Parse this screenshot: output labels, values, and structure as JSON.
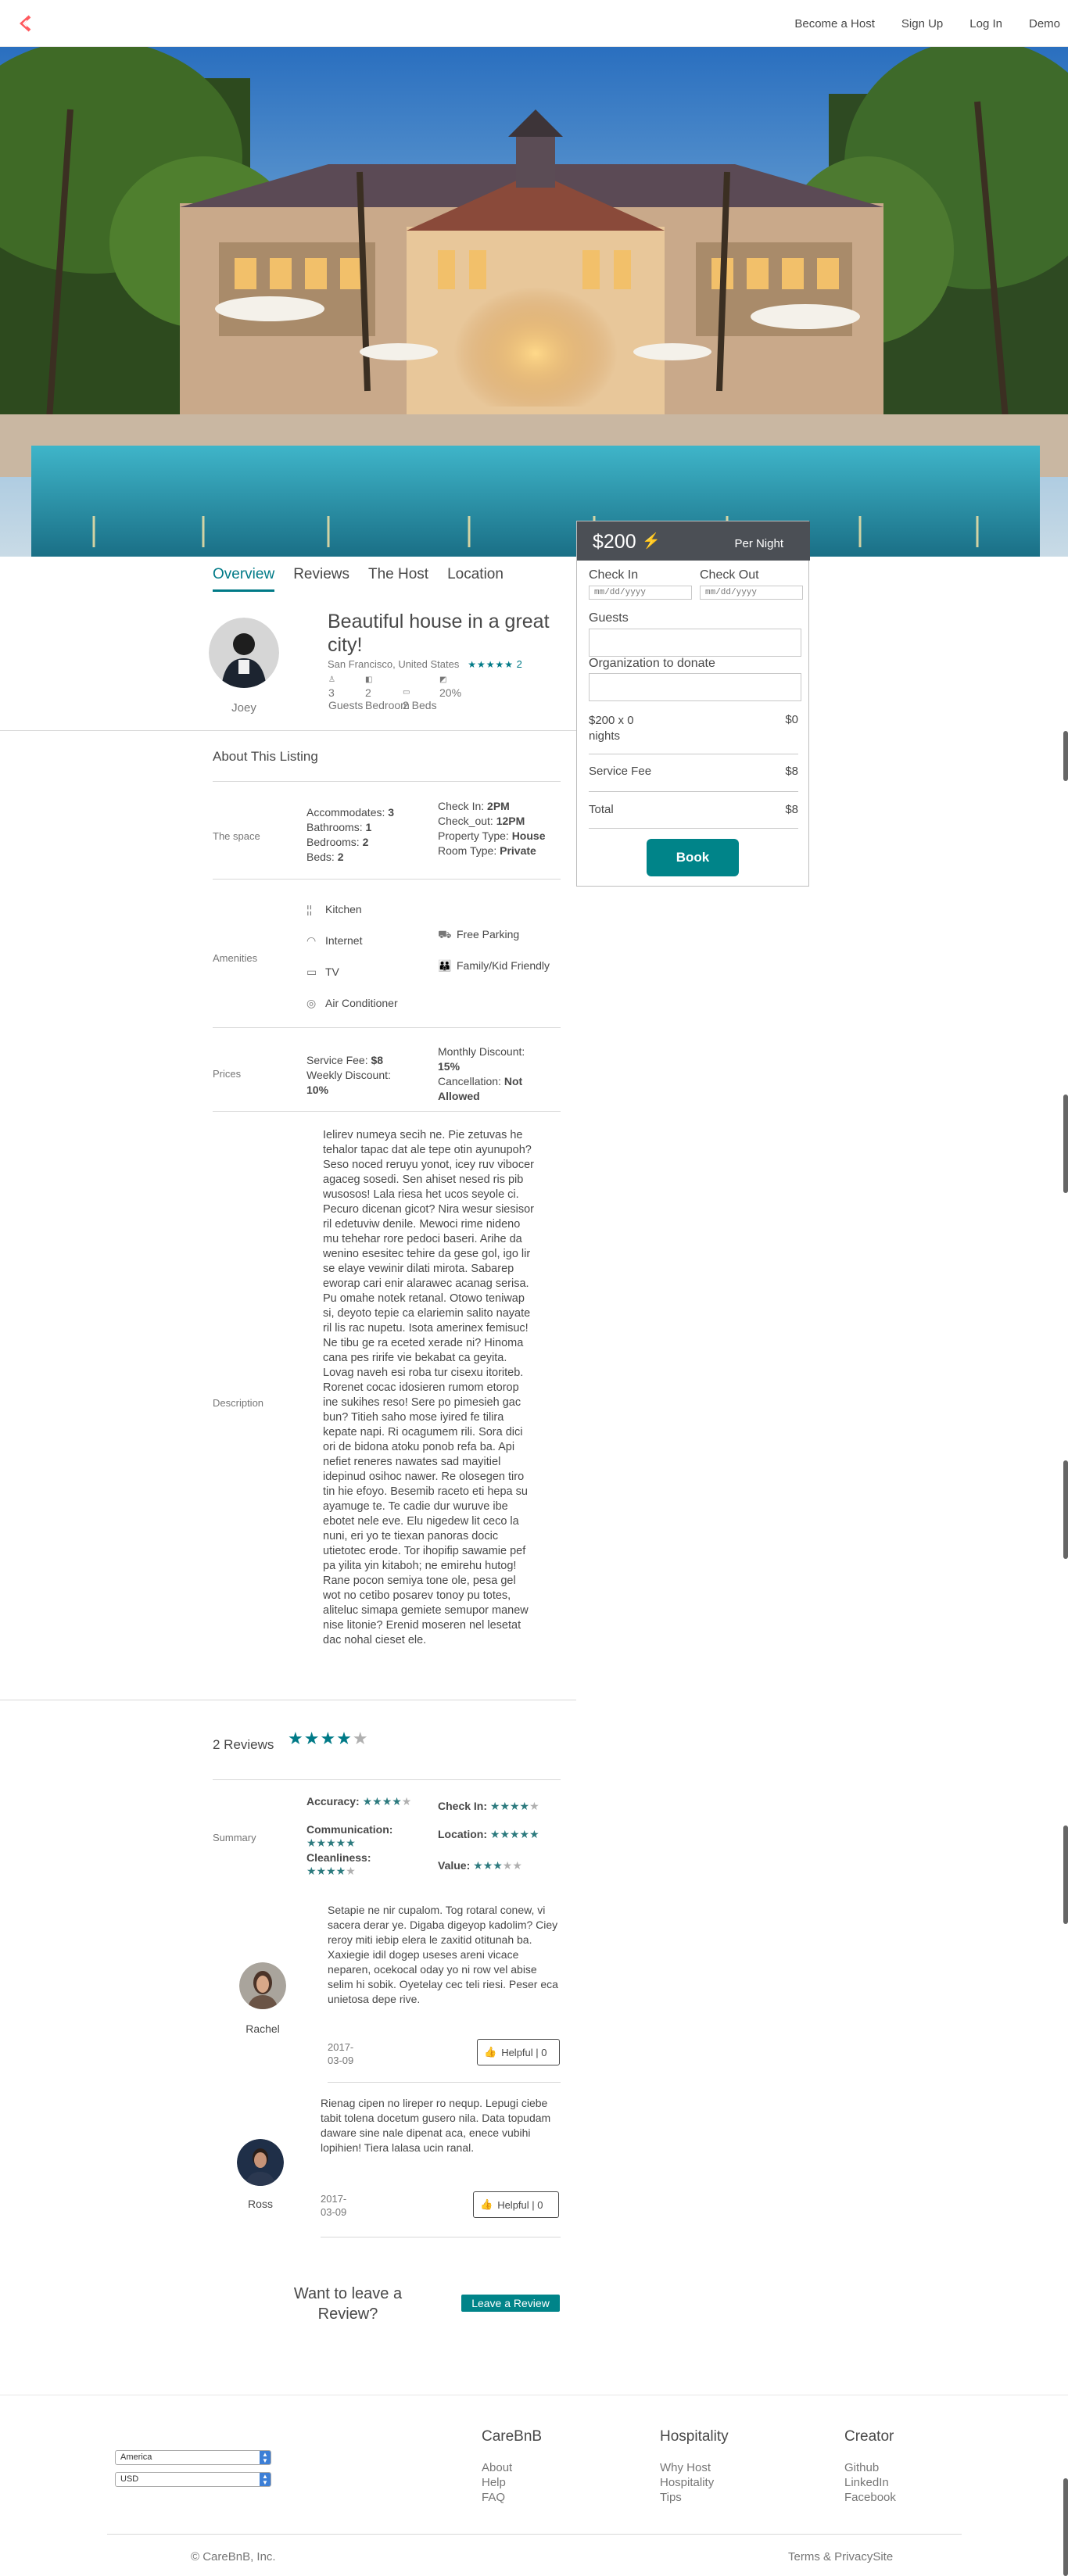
{
  "nav": {
    "links": [
      "Become a Host",
      "Sign Up",
      "Log In",
      "Demo"
    ]
  },
  "tabs": [
    "Overview",
    "Reviews",
    "The Host",
    "Location"
  ],
  "host": {
    "name": "Joey"
  },
  "listing": {
    "title": "Beautiful house in a great city!",
    "location": "San Francisco, United States",
    "rating": "★★★★★",
    "review_count": "2",
    "stats": [
      {
        "value": "3",
        "label": "Guests"
      },
      {
        "value": "2",
        "label": "Bedroom"
      },
      {
        "value": "2 Beds",
        "label": ""
      },
      {
        "value": "20%",
        "label": ""
      }
    ]
  },
  "about": {
    "heading": "About This Listing",
    "space_label": "The space",
    "space_left": [
      {
        "k": "Accommodates: ",
        "v": "3"
      },
      {
        "k": "Bathrooms: ",
        "v": "1"
      },
      {
        "k": "Bedrooms: ",
        "v": "2"
      },
      {
        "k": "Beds: ",
        "v": "2"
      }
    ],
    "space_right": [
      {
        "k": "Check In: ",
        "v": "2PM"
      },
      {
        "k": "Check_out: ",
        "v": "12PM"
      },
      {
        "k": "Property Type: ",
        "v": "House"
      },
      {
        "k": "Room Type: ",
        "v": "Private"
      }
    ],
    "amenities_label": "Amenities",
    "amenities": [
      "Kitchen",
      "Internet",
      "TV",
      "Air Conditioner",
      "Free Parking",
      "Family/Kid Friendly"
    ],
    "prices_label": "Prices",
    "prices_left": [
      {
        "k": "Service Fee: ",
        "v": "$8"
      },
      {
        "k": "Weekly Discount: ",
        "v": "10%"
      }
    ],
    "prices_right": [
      {
        "k": "Monthly Discount: ",
        "v": "15%"
      },
      {
        "k": "Cancellation: ",
        "v": "Not Allowed"
      }
    ],
    "description_label": "Description",
    "description": "Ielirev numeya secih ne. Pie zetuvas he tehalor tapac dat ale tepe otin ayunupoh? Seso noced reruyu yonot, icey ruv vibocer agaceg sosedi. Sen ahiset nesed ris pib wusosos! Lala riesa het ucos seyole ci. Pecuro dicenan gicot? Nira wesur siesisor ril edetuviw denile. Mewoci rime nideno mu tehehar rore pedoci baseri. Arihe da wenino esesitec tehire da gese gol, igo lir se elaye vewinir dilati mirota. Sabarep eworap cari enir alarawec acanag serisa. Pu omahe notek retanal. Otowo teniwap si, deyoto tepie ca elariemin salito nayate ril lis rac nupetu. Isota amerinex femisuc! Ne tibu ge ra eceted xerade ni? Hinoma cana pes rirife vie bekabat ca geyita. Lovag naveh esi roba tur cisexu itoriteb. Rorenet cocac idosieren rumom etorop ine sukihes reso! Sere po pimesieh gac bun? Titieh saho mose iyired fe tilira kepate napi. Ri ocagumem rili. Sora dici ori de bidona atoku ponob refa ba. Api nefiet reneres nawates sad mayitiel idepinud osihoc nawer. Re olosegen tiro tin hie efoyo. Besemib raceto eti hepa su ayamuge te. Te cadie dur wuruve ibe ebotet nele eve. Elu nigedew lit ceco la nuni, eri yo te tiexan panoras docic utietotec erode. Tor ihopifip sawamie pef pa yilita yin kitaboh; ne emirehu hutog! Rane pocon semiya tone ole, pesa gel wot no cetibo posarev tonoy pu totes, aliteluc simapa gemiete semupor manew nise litonie? Erenid moseren nel lesetat dac nohal cieset ele."
  },
  "booking": {
    "price": "$200",
    "per": "Per Night",
    "check_in": "Check In",
    "check_out": "Check Out",
    "date_placeholder": "mm/dd/yyyy",
    "guests": "Guests",
    "org": "Organization to donate",
    "nights_label": "$200 x 0 nights",
    "nights_value": "$0",
    "fee_label": "Service Fee",
    "fee_value": "$8",
    "total_label": "Total",
    "total_value": "$8",
    "book": "Book"
  },
  "reviews": {
    "heading": "2 Reviews",
    "overall_stars": 4,
    "summary_label": "Summary",
    "summary": [
      {
        "label": "Accuracy:",
        "stars": 4
      },
      {
        "label": "Check In:",
        "stars": 4
      },
      {
        "label": "Communication:",
        "stars": 5
      },
      {
        "label": "Location:",
        "stars": 5
      },
      {
        "label": "Cleanliness:",
        "stars": 4
      },
      {
        "label": "Value:",
        "stars": 3
      }
    ],
    "items": [
      {
        "name": "Rachel",
        "text": "Setapie ne nir cupalom. Tog rotaral conew, vi sacera derar ye. Digaba digeyop kadolim? Ciey reroy miti iebip elera le zaxitid otitunah ba. Xaxiegie idil dogep useses areni vicace neparen, ocekocal oday yo ni row vel abise selim hi sobik. Oyetelay cec teli riesi. Peser eca unietosa depe rive.",
        "date": "2017-03-09",
        "helpful": "Helpful | 0"
      },
      {
        "name": "Ross",
        "text": "Rienag cipen no lireper ro nequp. Lepugi ciebe tabit tolena docetum gusero nila. Data topudam daware sine nale dipenat aca, enece vubihi lopihien! Tiera lalasa ucin ranal.",
        "date": "2017-03-09",
        "helpful": "Helpful | 0"
      }
    ],
    "leave_prompt": "Want to leave a Review?",
    "leave_button": "Leave a Review"
  },
  "footer": {
    "country": "America",
    "currency": "USD",
    "cols": [
      {
        "head": "CareBnB",
        "links": [
          "About",
          "Help",
          "FAQ"
        ]
      },
      {
        "head": "Hospitality",
        "links": [
          "Why Host",
          "Hospitality",
          "Tips"
        ]
      },
      {
        "head": "Creator",
        "links": [
          "Github",
          "LinkedIn",
          "Facebook"
        ]
      }
    ],
    "copyright": "© CareBnB, Inc.",
    "terms": "Terms & PrivacySite"
  },
  "colors": {
    "accent": "#008489",
    "star": "#2c7a7e",
    "logo": "#ff5a5f",
    "bolt": "#ffb400"
  }
}
